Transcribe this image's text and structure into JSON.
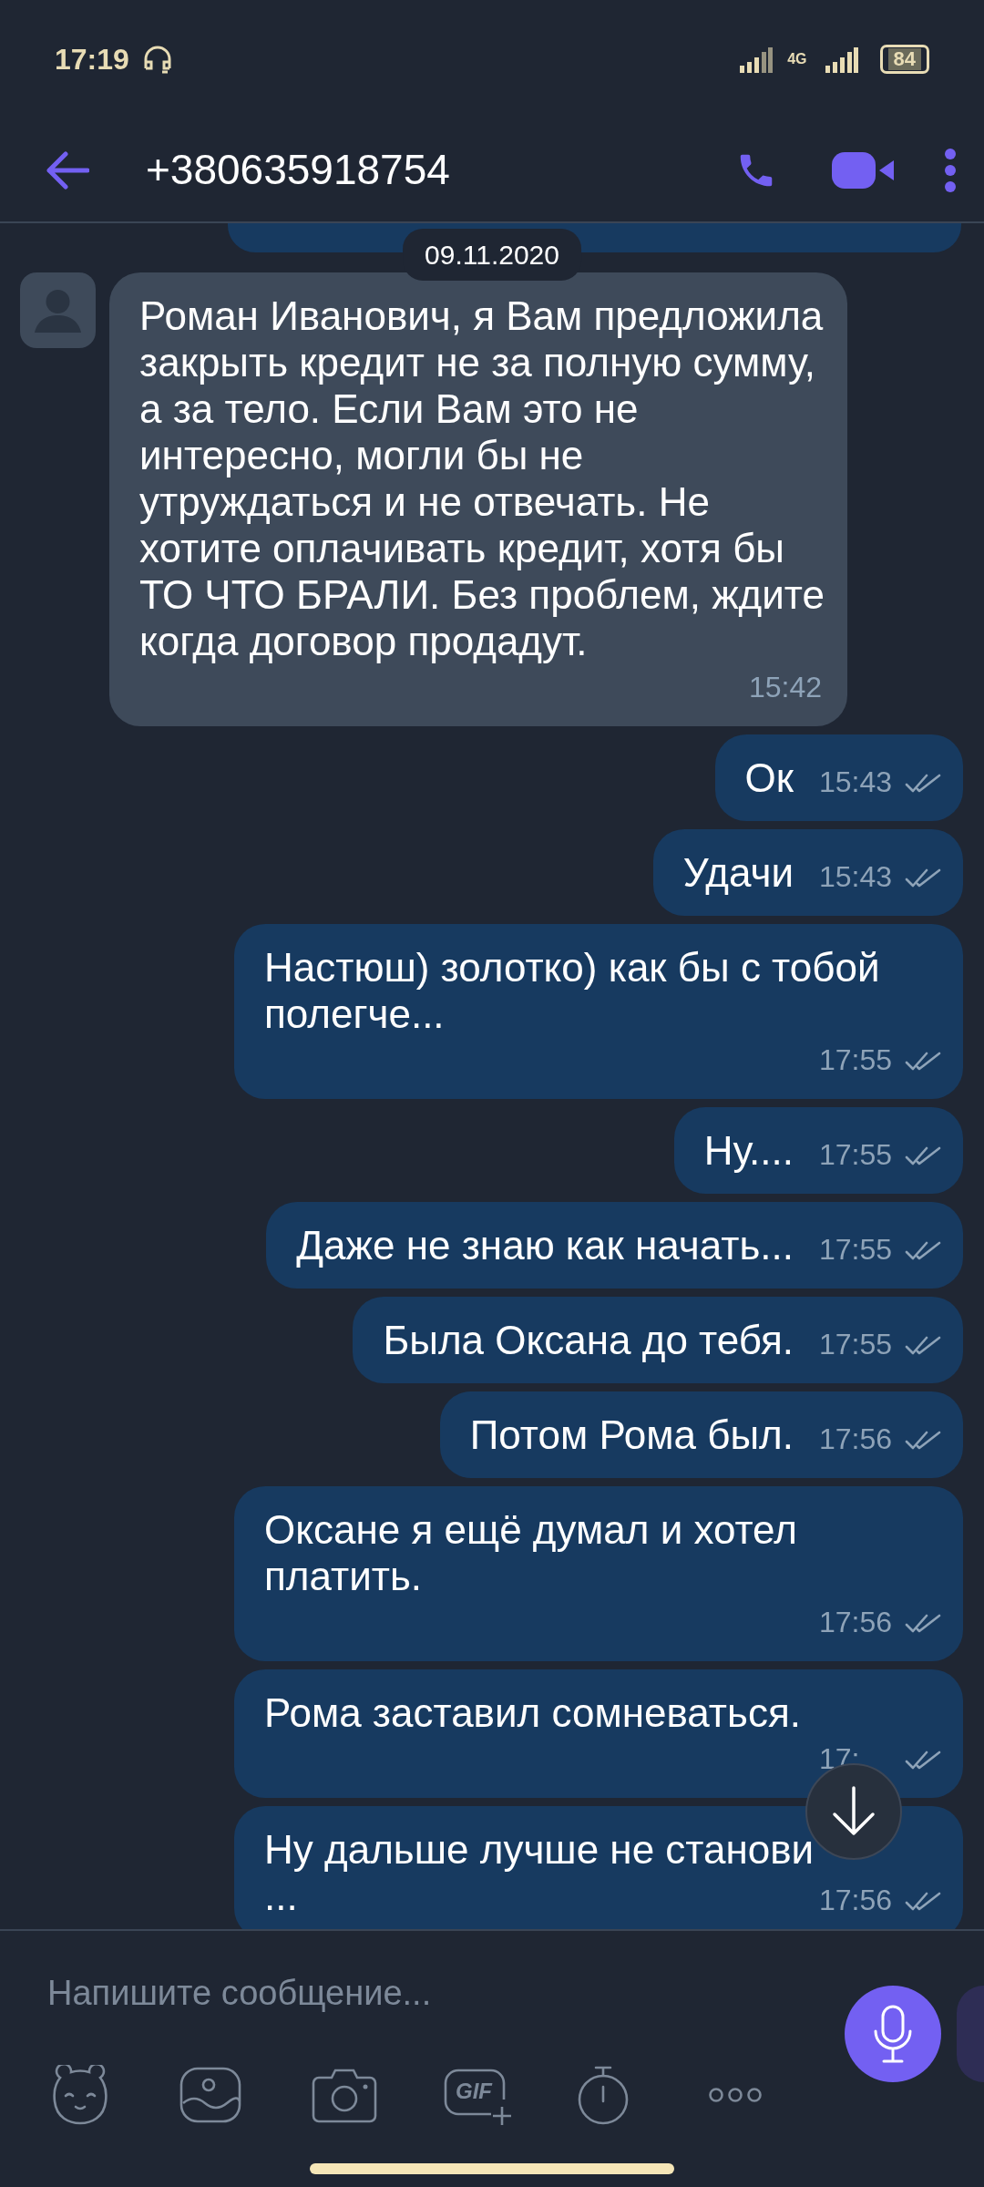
{
  "status_bar": {
    "time": "17:19",
    "network": "4G",
    "battery": "84"
  },
  "header": {
    "title": "+380635918754"
  },
  "date_chip": "09.11.2020",
  "messages": [
    {
      "kind": "incoming",
      "text": "Роман Иванович, я Вам предложила закрыть кредит не за полную сумму, а за тело. Если Вам это не интересно, могли бы не утруждаться и не отвечать. Не хотите оплачивать кредит, хотя бы ТО ЧТО БРАЛИ. Без проблем, ждите когда договор продадут.",
      "time": "15:42"
    },
    {
      "kind": "outgoing",
      "text": "Ок",
      "time": "15:43"
    },
    {
      "kind": "outgoing",
      "text": "Удачи",
      "time": "15:43"
    },
    {
      "kind": "outgoing",
      "text": "Настюш) золотко) как бы с тобой полегче...",
      "time": "17:55"
    },
    {
      "kind": "outgoing",
      "text": "Ну....",
      "time": "17:55"
    },
    {
      "kind": "outgoing",
      "text": "Даже не знаю как начать...",
      "time": "17:55"
    },
    {
      "kind": "outgoing",
      "text": "Была Оксана до тебя.",
      "time": "17:55"
    },
    {
      "kind": "outgoing",
      "text": "Потом Рома был.",
      "time": "17:56"
    },
    {
      "kind": "outgoing",
      "text": "Оксане я ещё думал и хотел платить.",
      "time": "17:56"
    },
    {
      "kind": "outgoing",
      "text": "Рома заставил сомневаться.",
      "time": "17:"
    },
    {
      "kind": "outgoing",
      "text": "Ну дальше лучше не станови",
      "text_tail": "...",
      "time": "17:56"
    }
  ],
  "composer": {
    "placeholder": "Напишите сообщение...",
    "tools": [
      {
        "kind": "sticker"
      },
      {
        "kind": "gallery"
      },
      {
        "kind": "camera"
      },
      {
        "kind": "gif",
        "label": "GIF"
      },
      {
        "kind": "timer"
      },
      {
        "kind": "more"
      }
    ]
  }
}
